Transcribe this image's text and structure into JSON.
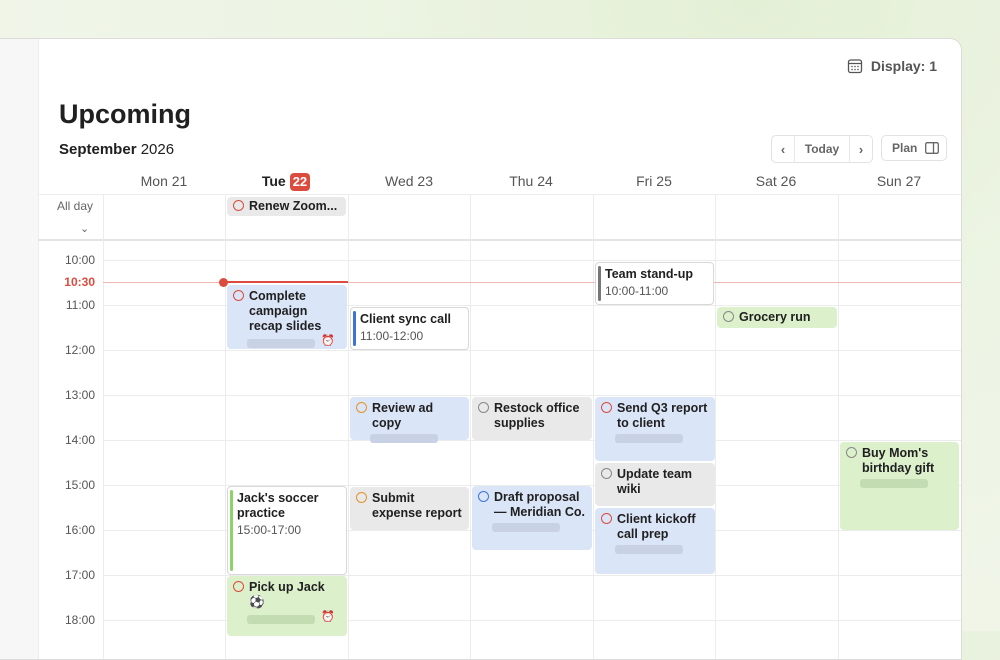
{
  "toolbar": {
    "display_label": "Display: 1"
  },
  "page": {
    "title": "Upcoming",
    "month": "September",
    "year": "2026"
  },
  "nav": {
    "prev": "‹",
    "today": "Today",
    "next": "›",
    "plan": "Plan"
  },
  "days": [
    {
      "label": "Mon 21"
    },
    {
      "label": "Tue",
      "num": "22"
    },
    {
      "label": "Wed 23"
    },
    {
      "label": "Thu 24"
    },
    {
      "label": "Fri 25"
    },
    {
      "label": "Sat 26"
    },
    {
      "label": "Sun 27"
    }
  ],
  "allday": {
    "label": "All day",
    "event": "Renew Zoom..."
  },
  "hours": [
    "10:00",
    "11:00",
    "12:00",
    "13:00",
    "14:00",
    "15:00",
    "16:00",
    "17:00",
    "18:00"
  ],
  "now": "10:30",
  "events": {
    "campaign": {
      "title": "Complete campaign recap slides"
    },
    "client_sync": {
      "title": "Client sync call",
      "time": "11:00-12:00"
    },
    "standup": {
      "title": "Team stand-up",
      "time": "10:00-11:00"
    },
    "grocery": {
      "title": "Grocery run"
    },
    "ad_copy": {
      "title": "Review ad copy"
    },
    "restock": {
      "title": "Restock office supplies"
    },
    "q3": {
      "title": "Send Q3 report to client"
    },
    "gift": {
      "title": "Buy Mom's birthday gift"
    },
    "wiki": {
      "title": "Update team wiki"
    },
    "soccer": {
      "title": "Jack's soccer practice",
      "time": "15:00-17:00"
    },
    "expense": {
      "title": "Submit expense report"
    },
    "proposal": {
      "title": "Draft proposal — Meridian Co."
    },
    "kickoff": {
      "title": "Client kickoff call prep"
    },
    "pickup": {
      "title": "Pick up Jack ⚽"
    }
  },
  "colors": {
    "accent": "#dc4c3e",
    "task_blue": "#dbe5f8",
    "task_gray": "#e9e9e9",
    "task_green": "#dcf0cc"
  }
}
